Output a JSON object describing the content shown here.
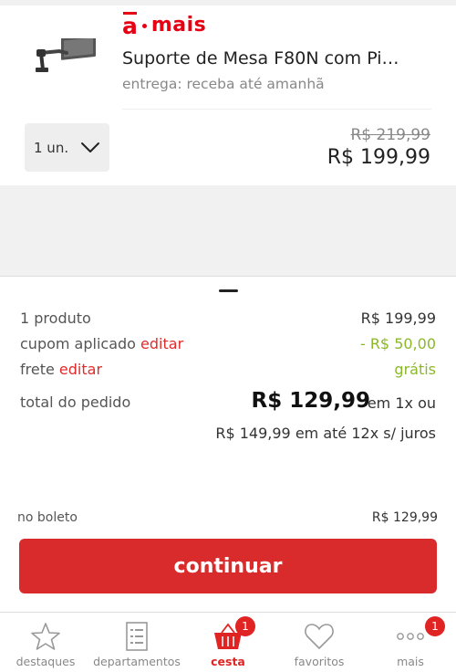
{
  "seller": {
    "logo_letter": "a",
    "logo_name": "mais"
  },
  "product": {
    "title": "Suporte de Mesa F80N com Pi…",
    "delivery": "entrega: receba até amanhã",
    "image_icon": "monitor-arm-icon",
    "quantity": "1 un.",
    "old_price": "R$ 219,99",
    "price": "R$ 199,99"
  },
  "summary": {
    "products_label": "1 produto",
    "products_value": "R$ 199,99",
    "coupon_label": "cupom aplicado",
    "coupon_edit": "editar",
    "coupon_value": "- R$ 50,00",
    "shipping_label": "frete",
    "shipping_edit": "editar",
    "shipping_value": "grátis",
    "total_label": "total do pedido",
    "total_value": "R$ 129,99",
    "total_suffix": "em 1x ou",
    "installments": "R$ 149,99 em até 12x s/ juros",
    "boleto_label": "no boleto",
    "boleto_value": "R$ 129,99",
    "continue_label": "continuar"
  },
  "tabs": [
    {
      "label": "destaques",
      "icon": "star-icon"
    },
    {
      "label": "departamentos",
      "icon": "list-icon"
    },
    {
      "label": "cesta",
      "icon": "basket-icon",
      "badge": "1",
      "active": true
    },
    {
      "label": "favoritos",
      "icon": "heart-icon"
    },
    {
      "label": "mais",
      "icon": "more-icon",
      "badge": "1"
    }
  ],
  "colors": {
    "brand_red": "#e60014",
    "button_red": "#d92b2b",
    "discount_green": "#8ab829"
  }
}
